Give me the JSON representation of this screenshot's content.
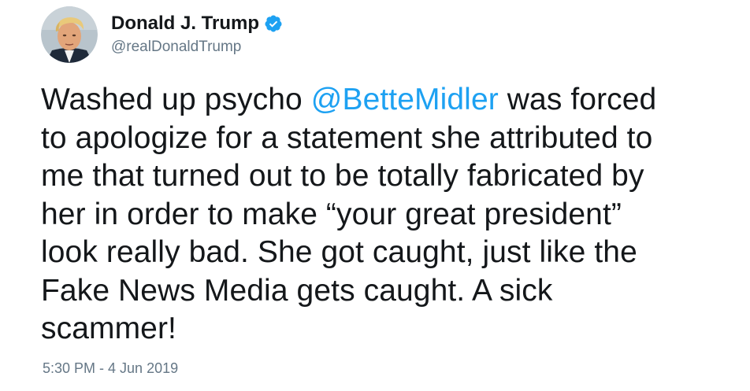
{
  "author": {
    "display_name": "Donald J. Trump",
    "handle": "@realDonaldTrump",
    "verified": true,
    "verified_icon": "verified-badge-icon",
    "avatar": "profile-photo"
  },
  "tweet": {
    "line1_pre": "Washed up psycho ",
    "mention": "@BetteMidler",
    "line1_post": " was forced",
    "line2": "to apologize for a statement she attributed to",
    "line3": "me that turned out to be totally fabricated by",
    "line4": "her in order to make “your great president”",
    "line5": "look really bad. She got caught, just like the",
    "line6": "Fake News Media gets caught. A sick",
    "line7": "scammer!"
  },
  "timestamp": "5:30 PM - 4 Jun 2019",
  "colors": {
    "text": "#14171a",
    "secondary": "#657786",
    "link": "#1da1f2",
    "verified": "#1da1f2"
  }
}
